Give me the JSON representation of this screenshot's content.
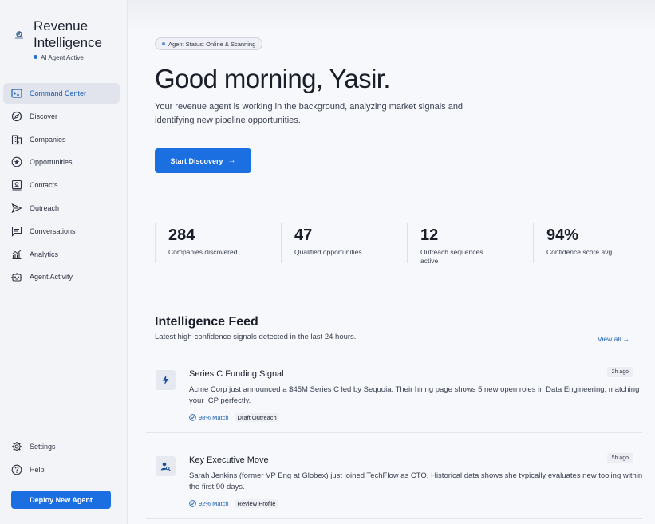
{
  "brand": {
    "title": "Revenue Intelligence",
    "status": "AI Agent Active"
  },
  "sidebar": {
    "items": [
      {
        "label": "Command Center",
        "icon": "terminal-icon"
      },
      {
        "label": "Discover",
        "icon": "compass-icon"
      },
      {
        "label": "Companies",
        "icon": "building-icon"
      },
      {
        "label": "Opportunities",
        "icon": "star-icon"
      },
      {
        "label": "Contacts",
        "icon": "contact-card-icon"
      },
      {
        "label": "Outreach",
        "icon": "send-icon"
      },
      {
        "label": "Conversations",
        "icon": "chat-icon"
      },
      {
        "label": "Analytics",
        "icon": "chart-icon"
      },
      {
        "label": "Agent Activity",
        "icon": "robot-icon"
      }
    ],
    "bottom": [
      {
        "label": "Settings",
        "icon": "gear-icon"
      },
      {
        "label": "Help",
        "icon": "help-icon"
      }
    ],
    "deploy_label": "Deploy New Agent"
  },
  "header": {
    "status_pill": "Agent Status: Online & Scanning",
    "greeting": "Good morning, Yasir.",
    "intro": "Your revenue agent is working in the background, analyzing market signals and identifying new pipeline opportunities.",
    "start_label": "Start Discovery",
    "start_arrow": "→"
  },
  "stats": [
    {
      "value": "284",
      "label": "Companies discovered"
    },
    {
      "value": "47",
      "label": "Qualified opportunities"
    },
    {
      "value": "12",
      "label": "Outreach sequences active"
    },
    {
      "value": "94%",
      "label": "Confidence score avg."
    }
  ],
  "feed": {
    "title": "Intelligence Feed",
    "subtitle": "Latest high-confidence signals detected in the last 24 hours.",
    "view_all": "View all →",
    "cards": [
      {
        "title": "Series C Funding Signal",
        "time": "2h ago",
        "body": "Acme Corp just announced a $45M Series C led by Sequoia. Their hiring page shows 5 new open roles in Data Engineering, matching your ICP perfectly.",
        "match": "98% Match",
        "action": "Draft Outreach",
        "icon": "lightning-icon"
      },
      {
        "title": "Key Executive Move",
        "time": "5h ago",
        "body": "Sarah Jenkins (former VP Eng at Globex) just joined TechFlow as CTO. Historical data shows she typically evaluates new tooling within the first 90 days.",
        "match": "92% Match",
        "action": "Review Profile",
        "icon": "person-search-icon"
      }
    ]
  },
  "colors": {
    "accent": "#1b6fe0",
    "link": "#1a5fb4",
    "sidebar_bg": "#f3f4f8",
    "page_bg": "#f7f8fb"
  }
}
